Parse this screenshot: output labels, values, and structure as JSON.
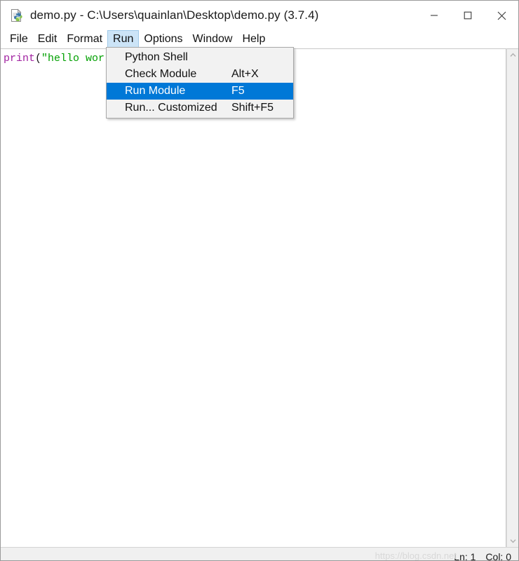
{
  "window": {
    "title": "demo.py - C:\\Users\\quainlan\\Desktop\\demo.py (3.7.4)",
    "icon": "python-file-icon",
    "controls": {
      "minimize_label": "Minimize",
      "maximize_label": "Maximize",
      "close_label": "Close"
    }
  },
  "menubar": {
    "items": [
      {
        "label": "File",
        "active": false
      },
      {
        "label": "Edit",
        "active": false
      },
      {
        "label": "Format",
        "active": false
      },
      {
        "label": "Run",
        "active": true
      },
      {
        "label": "Options",
        "active": false
      },
      {
        "label": "Window",
        "active": false
      },
      {
        "label": "Help",
        "active": false
      }
    ]
  },
  "run_menu": {
    "items": [
      {
        "label": "Python Shell",
        "accel": "",
        "selected": false
      },
      {
        "label": "Check Module",
        "accel": "Alt+X",
        "selected": false
      },
      {
        "label": "Run Module",
        "accel": "F5",
        "selected": true
      },
      {
        "label": "Run... Customized",
        "accel": "Shift+F5",
        "selected": false
      }
    ]
  },
  "editor": {
    "code": {
      "fn": "print",
      "paren": "(",
      "string": "\"hello wor"
    }
  },
  "scrollbar": {
    "up_icon": "chevron-up-icon",
    "down_icon": "chevron-down-icon"
  },
  "statusbar": {
    "line": "Ln: 1",
    "column": "Col: 0",
    "watermark": "https://blog.csdn.net"
  },
  "colors": {
    "accent_blue": "#0078d7",
    "menu_highlight": "#cce4f7",
    "keyword_purple": "#a020a0",
    "string_green": "#00a000",
    "statusbar_bg": "#f0f0f0",
    "dropdown_bg": "#f2f2f2"
  }
}
